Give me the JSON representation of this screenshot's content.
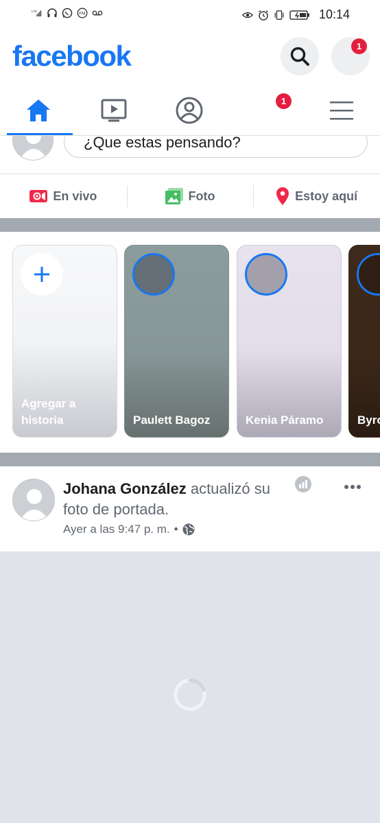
{
  "status_bar": {
    "network": "LTE",
    "time": "10:14",
    "left_icons": [
      "signal-icon",
      "headset-icon",
      "whatsapp-icon",
      "fm-radio-icon",
      "voicemail-icon"
    ],
    "right_icons": [
      "eye-comfort-icon",
      "alarm-icon",
      "vibrate-icon",
      "battery-icon"
    ]
  },
  "header": {
    "logo": "facebook",
    "search_icon": "search-icon",
    "messenger_icon": "messenger-icon",
    "messenger_badge": "1"
  },
  "tabs": [
    {
      "name": "home",
      "icon": "home-icon",
      "active": true
    },
    {
      "name": "watch",
      "icon": "video-icon",
      "active": false
    },
    {
      "name": "profile",
      "icon": "profile-icon",
      "active": false
    },
    {
      "name": "notifications",
      "icon": "bell-icon",
      "active": false,
      "badge": "1"
    },
    {
      "name": "menu",
      "icon": "hamburger-menu-icon",
      "active": false
    }
  ],
  "composer": {
    "placeholder": "¿Que estas pensando?"
  },
  "actions": [
    {
      "label": "En vivo",
      "icon": "live-video-icon",
      "color": "#f02849"
    },
    {
      "label": "Foto",
      "icon": "photo-icon",
      "color": "#45bd62"
    },
    {
      "label": "Estoy aquí",
      "icon": "location-pin-icon",
      "color": "#f5533d"
    }
  ],
  "stories": [
    {
      "label": "Agregar a historia",
      "icon": "plus-icon"
    },
    {
      "label": "Paulett Bagoz"
    },
    {
      "label": "Kenia Páramo"
    },
    {
      "label": "Byro"
    }
  ],
  "post": {
    "author": "Johana González",
    "action": " actualizó su foto de portada.",
    "time": "Ayer a las 9:47 p. m.",
    "separator": "•",
    "privacy_icon": "globe-icon",
    "menu_icon": "more-horizontal-icon"
  },
  "colors": {
    "brand": "#1877f2",
    "badge": "#e41e3f",
    "separator": "#a3a9b1",
    "media_background": "#e0e3ea"
  }
}
